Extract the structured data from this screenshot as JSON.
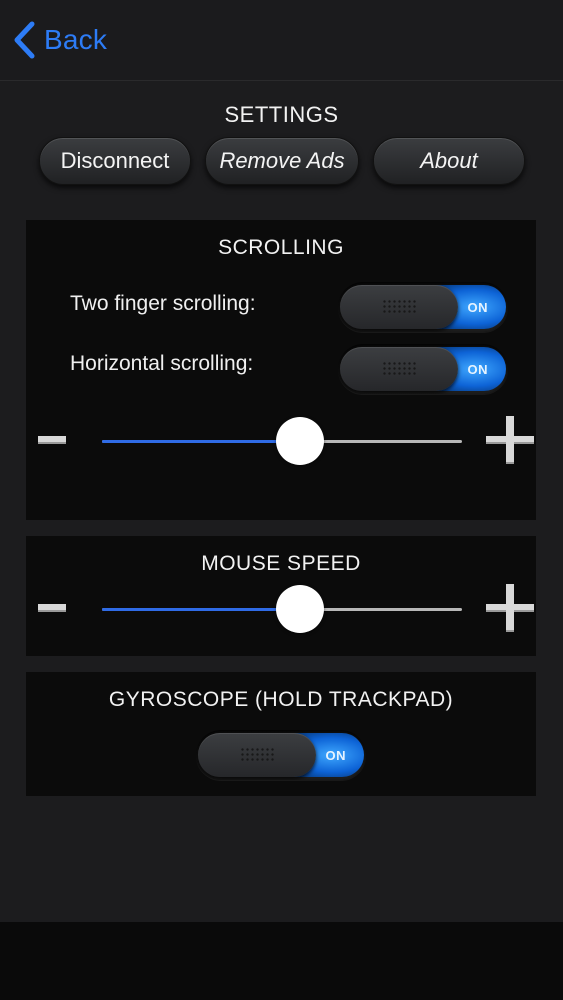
{
  "nav": {
    "back_label": "Back",
    "accent": "#2d7cf6"
  },
  "settings": {
    "title": "SETTINGS",
    "disconnect_label": "Disconnect",
    "remove_ads_label": "Remove Ads",
    "about_label": "About"
  },
  "scrolling": {
    "title": "SCROLLING",
    "two_finger_label": "Two finger scrolling:",
    "two_finger_state": "ON",
    "horizontal_label": "Horizontal scrolling:",
    "horizontal_state": "ON",
    "speed_fraction": 0.55
  },
  "mouse_speed": {
    "title": "MOUSE SPEED",
    "speed_fraction": 0.55
  },
  "gyroscope": {
    "title": "GYROSCOPE (HOLD TRACKPAD)",
    "state": "ON"
  },
  "icons": {
    "back": "chevron-left-icon",
    "decrease": "minus-icon",
    "increase": "plus-icon"
  }
}
